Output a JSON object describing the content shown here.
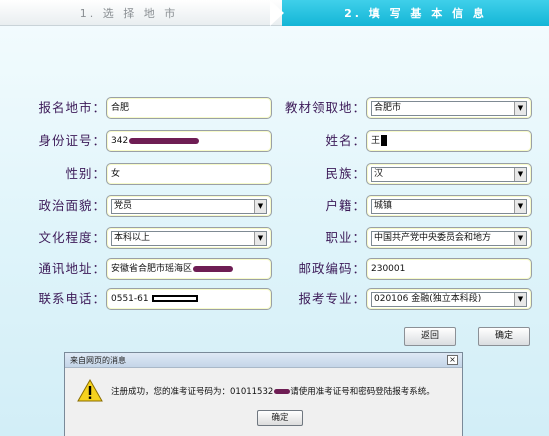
{
  "steps": {
    "step1": "1. 选 择 地 市",
    "step2": "2. 填 写 基 本 信 息"
  },
  "form": {
    "city_label": "报名地市：",
    "city_value": "合肥",
    "textbook_label": "教材领取地：",
    "textbook_value": "合肥市",
    "id_label": "身份证号：",
    "id_value": "342",
    "name_label": "姓名：",
    "name_value": "王",
    "gender_label": "性别：",
    "gender_value": "女",
    "ethnicity_label": "民族：",
    "ethnicity_value": "汉",
    "political_label": "政治面貌：",
    "political_value": "党员",
    "hukou_label": "户籍：",
    "hukou_value": "城镇",
    "education_label": "文化程度：",
    "education_value": "本科以上",
    "occupation_label": "职业：",
    "occupation_value": "中国共产党中央委员会和地方",
    "address_label": "通讯地址：",
    "address_value": "安徽省合肥市瑶海区",
    "postcode_label": "邮政编码：",
    "postcode_value": "230001",
    "phone_label": "联系电话：",
    "phone_value": "0551-61",
    "major_label": "报考专业：",
    "major_value": "020106 金融(独立本科段)"
  },
  "buttons": {
    "back": "返回",
    "confirm": "确定"
  },
  "dialog": {
    "title": "来自网页的消息",
    "close": "×",
    "message_prefix": "注册成功，您的准考证号码为：01011532",
    "message_suffix": "请使用准考证号和密码登陆报考系统。",
    "ok": "确定",
    "icon": "warning-icon"
  },
  "colors": {
    "step_active": "#14b5d6",
    "label": "#3c1a58",
    "redaction": "#6e1d54"
  }
}
